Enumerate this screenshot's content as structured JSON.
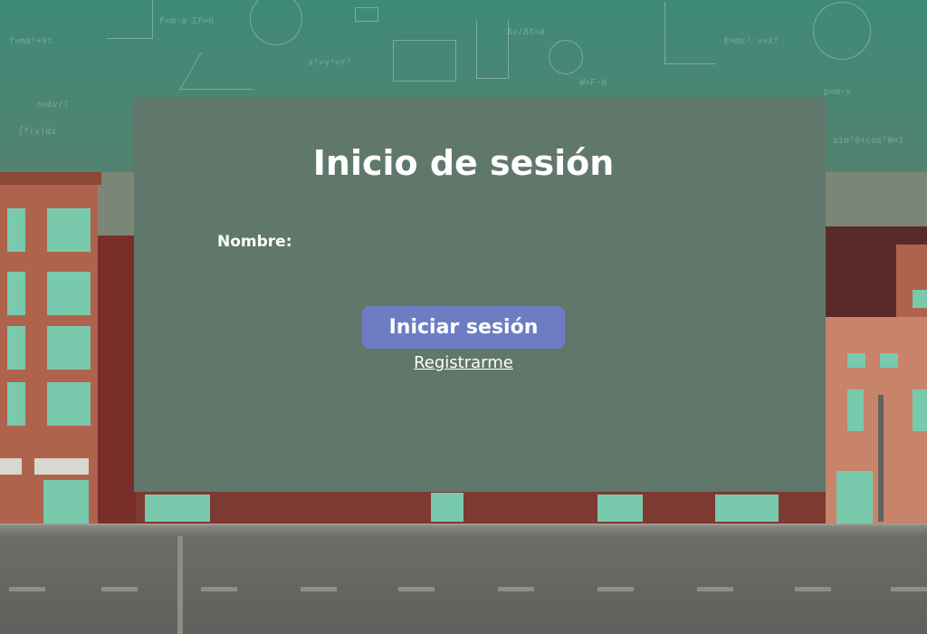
{
  "page": {
    "title": "Inicio de sesión"
  },
  "form": {
    "name_label": "Nombre:",
    "name_value": "",
    "submit_label": "Iniciar sesión",
    "register_link": "Registrarme"
  },
  "colors": {
    "panel": "#60786b",
    "button": "#6e7cc4",
    "text": "#ffffff",
    "chalkboard": "#4a8673"
  }
}
